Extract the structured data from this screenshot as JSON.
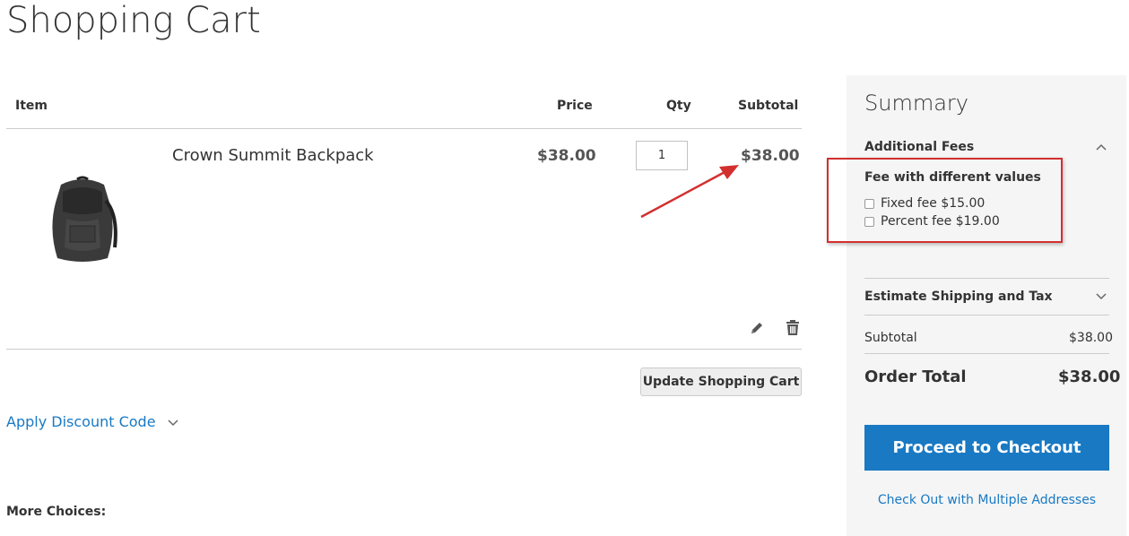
{
  "page": {
    "title": "Shopping Cart"
  },
  "cart": {
    "headers": {
      "item": "Item",
      "price": "Price",
      "qty": "Qty",
      "subtotal": "Subtotal"
    },
    "items": [
      {
        "name": "Crown Summit Backpack",
        "price": "$38.00",
        "qty": "1",
        "subtotal": "$38.00"
      }
    ],
    "update_label": "Update Shopping Cart",
    "discount_label": "Apply Discount Code",
    "more_choices": "More Choices:"
  },
  "summary": {
    "title": "Summary",
    "additional_fees": {
      "label": "Additional Fees",
      "group_title": "Fee with different values",
      "options": [
        {
          "label": "Fixed fee $15.00"
        },
        {
          "label": "Percent fee $19.00"
        }
      ]
    },
    "estimate_label": "Estimate Shipping and Tax",
    "subtotal_label": "Subtotal",
    "subtotal_value": "$38.00",
    "order_total_label": "Order Total",
    "order_total_value": "$38.00",
    "checkout_label": "Proceed to Checkout",
    "multi_address_label": "Check Out with Multiple Addresses"
  },
  "colors": {
    "accent": "#1979c3",
    "annotation": "#d32f2f"
  },
  "icons": {
    "edit": "pencil-icon",
    "delete": "trash-icon",
    "collapse": "chevron-up-icon",
    "expand": "chevron-down-icon"
  }
}
